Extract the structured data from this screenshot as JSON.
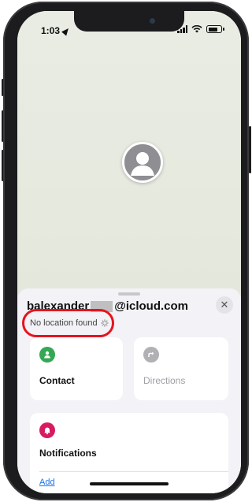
{
  "status_bar": {
    "time": "1:03",
    "battery_level": 0.8
  },
  "contact": {
    "email_prefix": "balexander",
    "email_domain": "@icloud.com",
    "location_status": "No location found",
    "close_label": "✕"
  },
  "actions": {
    "contact_label": "Contact",
    "directions_label": "Directions",
    "notifications_label": "Notifications",
    "add_label": "Add"
  },
  "colors": {
    "contact_icon": "#34a853",
    "directions_icon": "#b0b0b5",
    "notifications_icon": "#d81b60",
    "highlight": "#e6141e",
    "link": "#1a73e8"
  }
}
